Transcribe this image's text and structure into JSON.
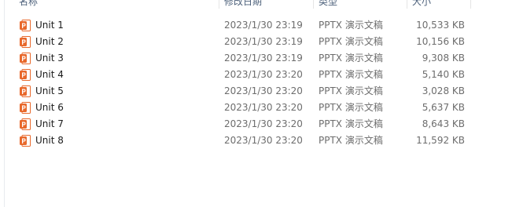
{
  "columns": {
    "name": "名称",
    "date_modified": "修改日期",
    "type": "类型",
    "size": "大小"
  },
  "files": [
    {
      "name": "Unit 1",
      "date": "2023/1/30 23:19",
      "type": "PPTX 演示文稿",
      "size": "10,533 KB",
      "icon": "pptx-file-icon"
    },
    {
      "name": "Unit 2",
      "date": "2023/1/30 23:19",
      "type": "PPTX 演示文稿",
      "size": "10,156 KB",
      "icon": "pptx-file-icon"
    },
    {
      "name": "Unit 3",
      "date": "2023/1/30 23:19",
      "type": "PPTX 演示文稿",
      "size": "9,308 KB",
      "icon": "pptx-file-icon"
    },
    {
      "name": "Unit 4",
      "date": "2023/1/30 23:20",
      "type": "PPTX 演示文稿",
      "size": "5,140 KB",
      "icon": "pptx-file-icon"
    },
    {
      "name": "Unit 5",
      "date": "2023/1/30 23:20",
      "type": "PPTX 演示文稿",
      "size": "3,028 KB",
      "icon": "pptx-file-icon"
    },
    {
      "name": "Unit 6",
      "date": "2023/1/30 23:20",
      "type": "PPTX 演示文稿",
      "size": "5,637 KB",
      "icon": "pptx-file-icon"
    },
    {
      "name": "Unit 7",
      "date": "2023/1/30 23:20",
      "type": "PPTX 演示文稿",
      "size": "8,643 KB",
      "icon": "pptx-file-icon"
    },
    {
      "name": "Unit 8",
      "date": "2023/1/30 23:20",
      "type": "PPTX 演示文稿",
      "size": "11,592 KB",
      "icon": "pptx-file-icon"
    }
  ],
  "colors": {
    "icon_orange": "#e8682b",
    "icon_page": "#ffffff",
    "header_text": "#4c607a"
  }
}
